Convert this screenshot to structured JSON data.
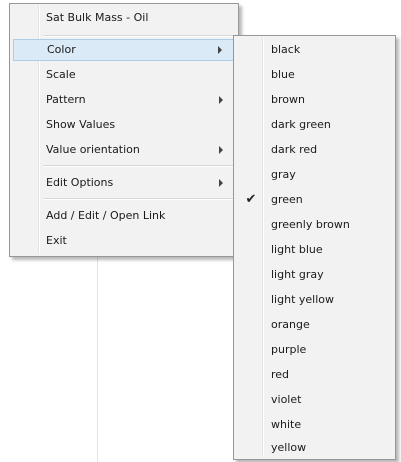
{
  "main_menu": {
    "header": "Sat Bulk Mass - Oil",
    "items": [
      {
        "label": "Color",
        "has_submenu": true,
        "highlighted": true
      },
      {
        "label": "Scale",
        "has_submenu": false
      },
      {
        "label": "Pattern",
        "has_submenu": true
      },
      {
        "label": "Show Values",
        "has_submenu": false
      },
      {
        "label": "Value orientation",
        "has_submenu": true
      },
      {
        "label": "Edit Options",
        "has_submenu": true
      },
      {
        "label": "Add / Edit / Open Link",
        "has_submenu": false
      },
      {
        "label": "Exit",
        "has_submenu": false
      }
    ]
  },
  "color_submenu": {
    "selected": "green",
    "check_glyph": "✔",
    "items": [
      {
        "label": "black"
      },
      {
        "label": "blue"
      },
      {
        "label": "brown"
      },
      {
        "label": "dark green"
      },
      {
        "label": "dark red"
      },
      {
        "label": "gray"
      },
      {
        "label": "green",
        "checked": true
      },
      {
        "label": "greenly brown"
      },
      {
        "label": "light blue"
      },
      {
        "label": "light gray"
      },
      {
        "label": "light yellow"
      },
      {
        "label": "orange"
      },
      {
        "label": "purple"
      },
      {
        "label": "red"
      },
      {
        "label": "violet"
      },
      {
        "label": "white"
      },
      {
        "label": "yellow"
      }
    ]
  },
  "colors": {
    "hover_bg": "#dbeaf7",
    "hover_border": "#a9cdeb",
    "menu_bg": "#f2f2f2"
  }
}
